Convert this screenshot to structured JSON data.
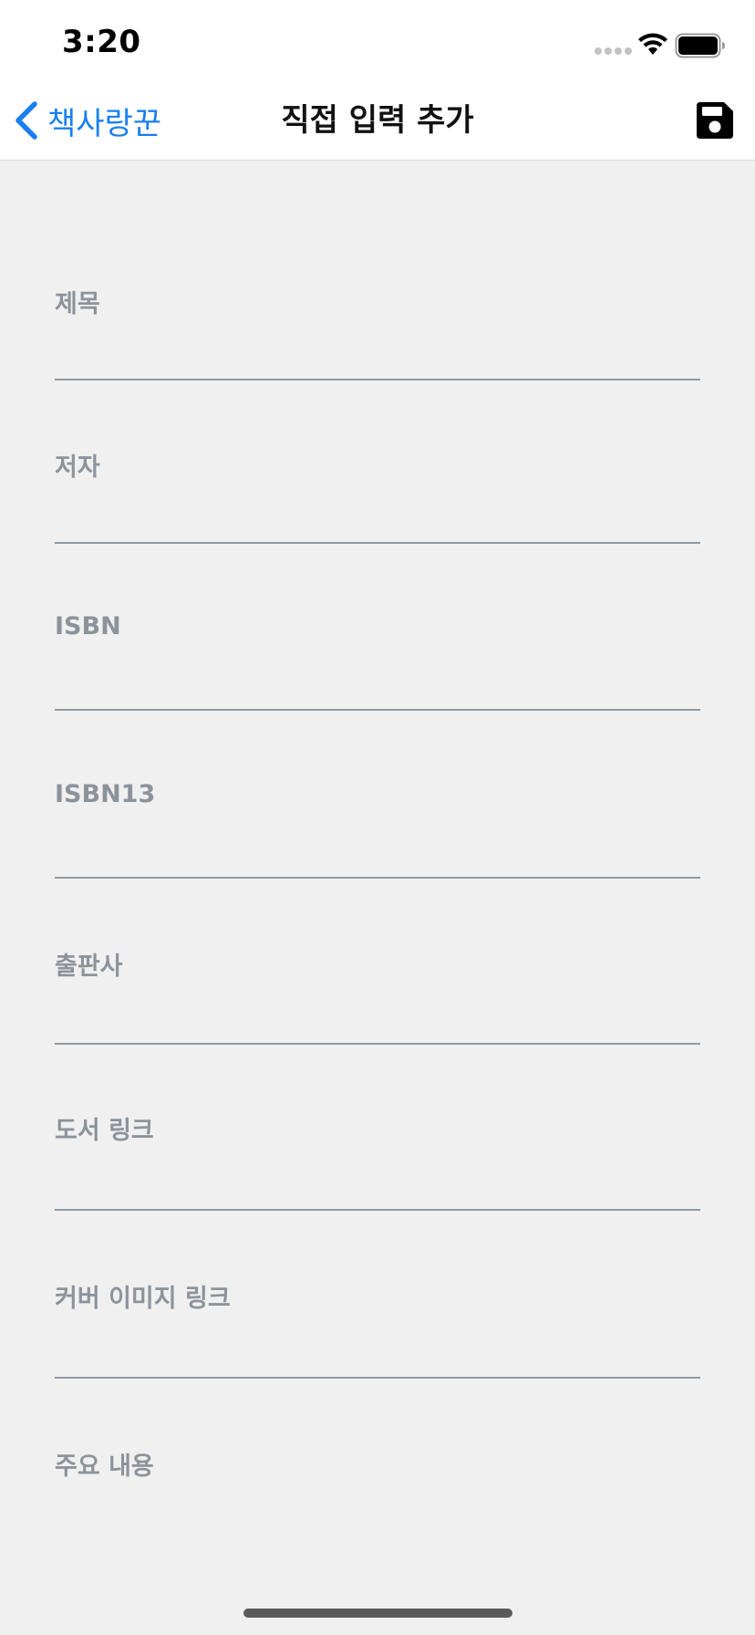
{
  "status_bar": {
    "time": "3:20"
  },
  "nav": {
    "back_label": "책사랑꾼",
    "title": "직접 입력 추가",
    "save_icon": "floppy-disk-icon"
  },
  "form": {
    "fields": [
      {
        "label": "제목",
        "value": ""
      },
      {
        "label": "저자",
        "value": ""
      },
      {
        "label": "ISBN",
        "value": ""
      },
      {
        "label": "ISBN13",
        "value": ""
      },
      {
        "label": "출판사",
        "value": ""
      },
      {
        "label": "도서 링크",
        "value": ""
      },
      {
        "label": "커버 이미지 링크",
        "value": ""
      },
      {
        "label": "주요 내용",
        "value": ""
      }
    ]
  },
  "colors": {
    "accent": "#1a7ff0",
    "label": "#8c939b",
    "underline": "#8e99a4",
    "background": "#f0f0f0"
  }
}
